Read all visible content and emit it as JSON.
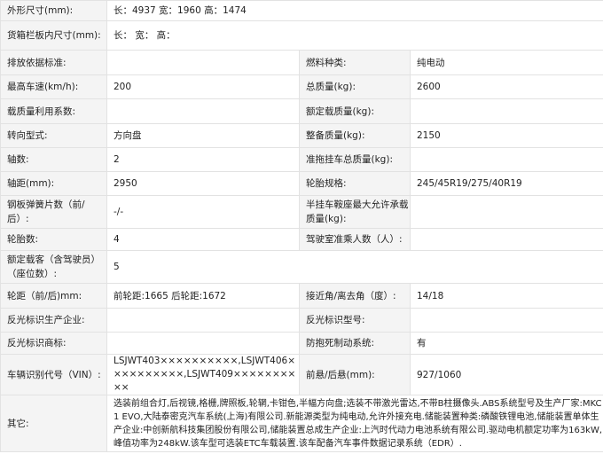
{
  "rows": {
    "dims": {
      "label": "外形尺寸(mm):",
      "value": "长：4937 宽：1960 高：1474"
    },
    "cargo": {
      "label": "货箱栏板内尺寸(mm):",
      "value": "长： 宽： 高："
    },
    "emission": {
      "label": "排放依据标准:",
      "value": "",
      "label2": "燃料种类:",
      "value2": "纯电动"
    },
    "speed": {
      "label": "最高车速(km/h):",
      "value": "200",
      "label2": "总质量(kg):",
      "value2": "2600"
    },
    "loadfactor": {
      "label": "载质量利用系数:",
      "value": "",
      "label2": "额定载质量(kg):",
      "value2": ""
    },
    "steering": {
      "label": "转向型式:",
      "value": "方向盘",
      "label2": "整备质量(kg):",
      "value2": "2150"
    },
    "axles": {
      "label": "轴数:",
      "value": "2",
      "label2": "准拖挂车总质量(kg):",
      "value2": ""
    },
    "wheelbase": {
      "label": "轴距(mm):",
      "value": "2950",
      "label2": "轮胎规格:",
      "value2": "245/45R19/275/40R19"
    },
    "springs": {
      "label": "钢板弹簧片数（前/后）:",
      "value": "-/-",
      "label2": "半挂车鞍座最大允许承载质量(kg):",
      "value2": ""
    },
    "tires": {
      "label": "轮胎数:",
      "value": "4",
      "label2": "驾驶室准乘人数（人）:",
      "value2": ""
    },
    "seats": {
      "label": "额定载客（含驾驶员）（座位数）:",
      "value": "5"
    },
    "track": {
      "label": "轮距（前/后)mm:",
      "value": "前轮距:1665 后轮距:1672",
      "label2": "接近角/离去角（度）:",
      "value2": "14/18"
    },
    "reflector_maker": {
      "label": "反光标识生产企业:",
      "value": "",
      "label2": "反光标识型号:",
      "value2": ""
    },
    "reflector_brand": {
      "label": "反光标识商标:",
      "value": "",
      "label2": "防抱死制动系统:",
      "value2": "有"
    },
    "vin": {
      "label": "车辆识别代号（VIN）:",
      "value": "LSJWT403××××××××××,LSJWT406××××××××××,LSJWT409××××××××××",
      "label2": "前悬/后悬(mm):",
      "value2": "927/1060"
    },
    "other": {
      "label": "其它:",
      "value": "选装前组合灯,后视镜,格栅,牌照板,轮辋,卡钳色,半幅方向盘;选装不带激光雷达,不带B柱摄像头.ABS系统型号及生产厂家:MKC1 EVO,大陆泰密克汽车系统(上海)有限公司.新能源类型为纯电动,允许外接充电.储能装置种类:磷酸铁锂电池,储能装置单体生产企业:中创新航科技集团股份有限公司,储能装置总成生产企业:上汽时代动力电池系统有限公司.驱动电机额定功率为163kW,峰值功率为248kW.该车型可选装ETC车载装置.该车配备汽车事件数据记录系统（EDR）."
    }
  }
}
